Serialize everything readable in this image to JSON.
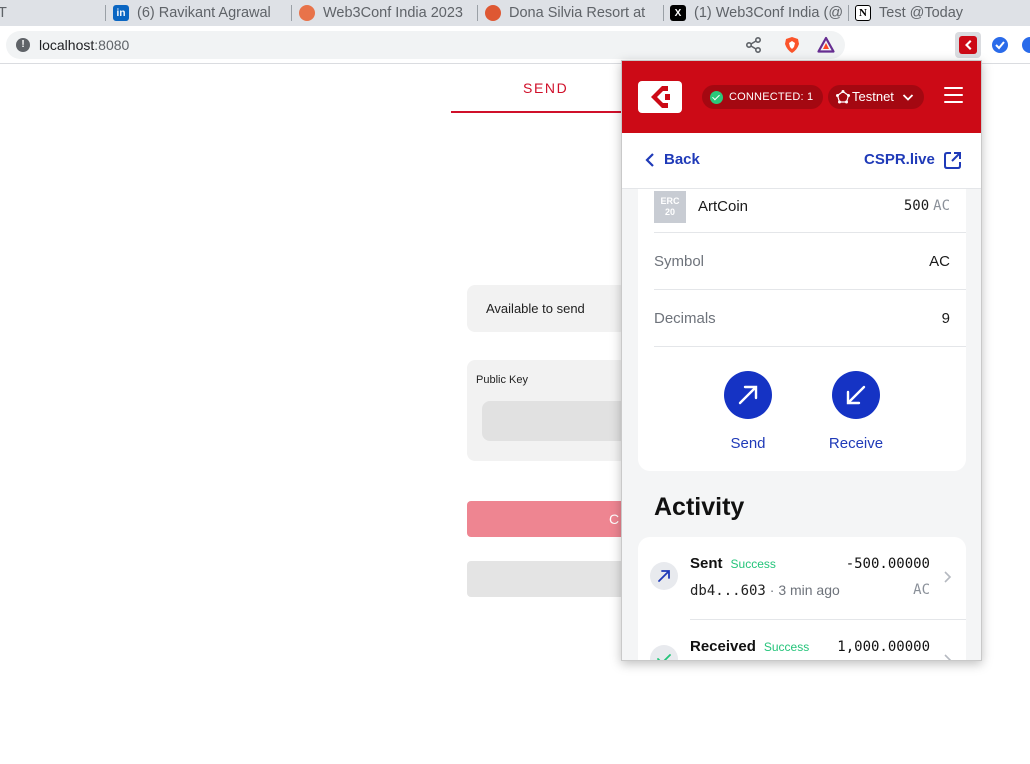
{
  "browser": {
    "tabs": [
      {
        "title": "T"
      },
      {
        "title": "(6) Ravikant Agrawal"
      },
      {
        "title": "Web3Conf India 2023"
      },
      {
        "title": "Dona Silvia Resort at"
      },
      {
        "title": "(1) Web3Conf India (@"
      },
      {
        "title": "Test @Today"
      }
    ],
    "url_host": "localhost",
    "url_port": ":8080"
  },
  "dapp": {
    "send_tab": "SEND",
    "available_label": "Available to send",
    "public_key_label": "Public Key",
    "primary_button_initial": "C"
  },
  "wallet": {
    "connected_label": "CONNECTED: 1",
    "network": "Testnet",
    "back_label": "Back",
    "explorer_link": "CSPR.live",
    "token": {
      "badge_line1": "ERC",
      "badge_line2": "20",
      "name": "ArtCoin",
      "balance": "500",
      "unit": "AC",
      "symbol_label": "Symbol",
      "symbol_value": "AC",
      "decimals_label": "Decimals",
      "decimals_value": "9"
    },
    "actions": {
      "send": "Send",
      "receive": "Receive"
    },
    "activity": {
      "title": "Activity",
      "items": [
        {
          "type": "Sent",
          "status": "Success",
          "amount": "-500.00000",
          "hash": "db4...603",
          "separator": "·",
          "time": "3 min ago",
          "unit": "AC"
        },
        {
          "type": "Received",
          "status": "Success",
          "amount": "1,000.00000"
        }
      ]
    }
  },
  "colors": {
    "brand_red": "#cc0a16",
    "accent_blue": "#1533c4",
    "success_green": "#24c47a"
  }
}
